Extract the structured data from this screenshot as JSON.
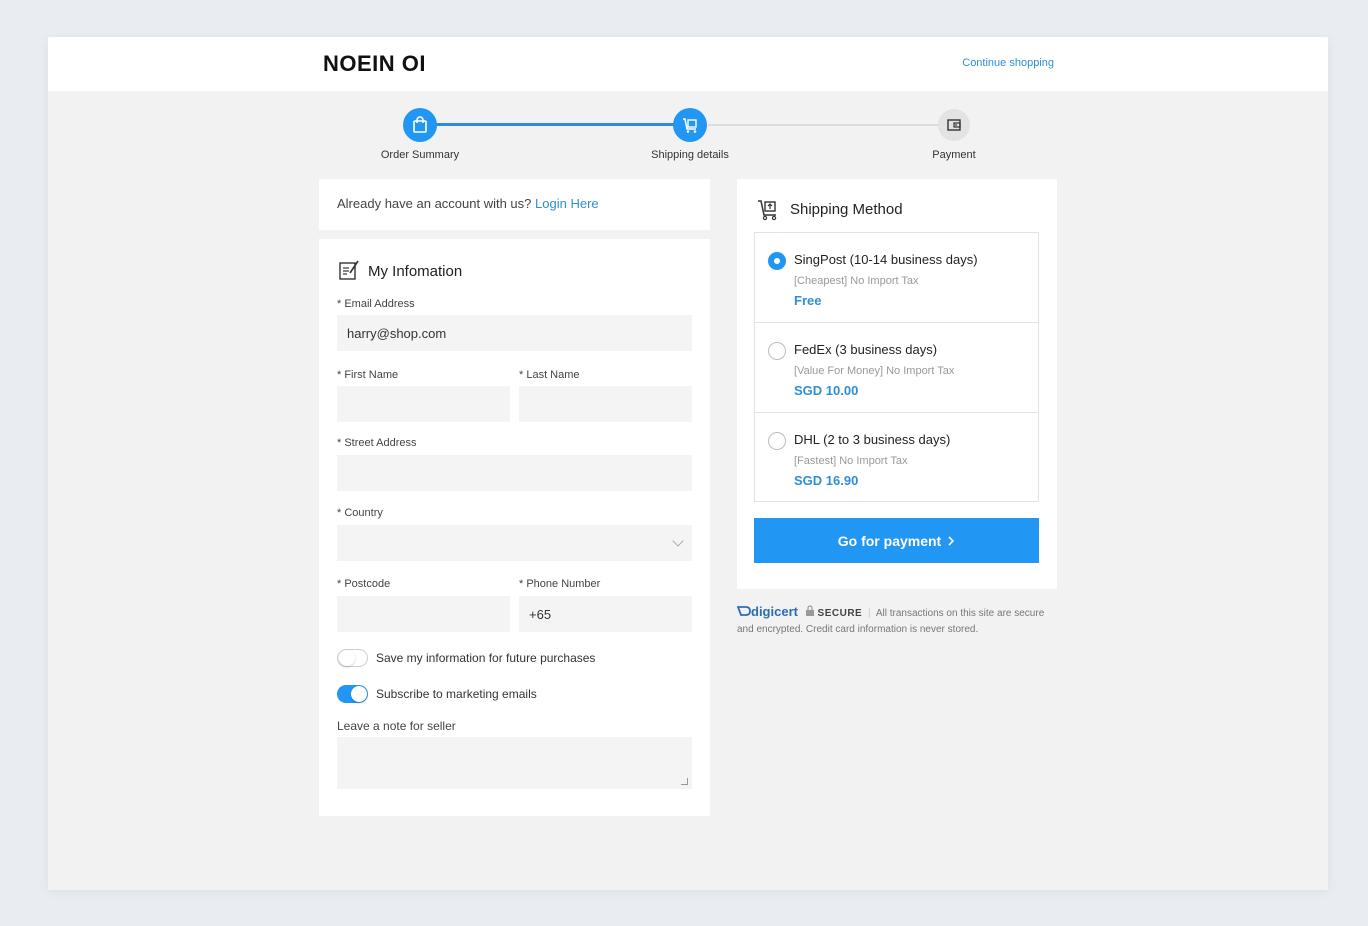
{
  "header": {
    "brand": "NOEIN OI",
    "continue_label": "Continue shopping"
  },
  "stepper": {
    "steps": [
      {
        "label": "Order Summary",
        "icon": "shopping-bag-icon",
        "state": "done"
      },
      {
        "label": "Shipping details",
        "icon": "shipping-icon",
        "state": "current"
      },
      {
        "label": "Payment",
        "icon": "wallet-icon",
        "state": "pending"
      }
    ]
  },
  "account": {
    "prompt": "Already have an account with us?",
    "login_label": "Login Here"
  },
  "info": {
    "title": "My Infomation",
    "email_label": "* Email Address",
    "email_value": "harry@shop.com",
    "first_name_label": "* First Name",
    "last_name_label": "* Last Name",
    "street_label": "* Street Address",
    "country_label": "* Country",
    "postcode_label": "* Postcode",
    "phone_label": "* Phone Number",
    "phone_value": "+65",
    "save_info_label": "Save my information for future purchases",
    "save_info_on": false,
    "subscribe_label": "Subscribe to marketing emails",
    "subscribe_on": true,
    "note_label": "Leave a note for seller"
  },
  "shipping": {
    "title": "Shipping Method",
    "methods": [
      {
        "name": "SingPost (10-14 business days)",
        "desc": "[Cheapest] No Import Tax",
        "price": "Free",
        "selected": true
      },
      {
        "name": "FedEx (3 business days)",
        "desc": "[Value For Money] No Import Tax",
        "price": "SGD 10.00",
        "selected": false
      },
      {
        "name": "DHL (2 to 3 business days)",
        "desc": "[Fastest] No Import Tax",
        "price": "SGD 16.90",
        "selected": false
      }
    ],
    "pay_button_label": "Go for payment"
  },
  "secure": {
    "brand": "digicert",
    "badge": "SECURE",
    "text": "All transactions on this site are secure and encrypted. Credit card information is never stored."
  },
  "colors": {
    "accent": "#2196f3",
    "link": "#2f8fd6",
    "background": "#f2f2f2"
  }
}
